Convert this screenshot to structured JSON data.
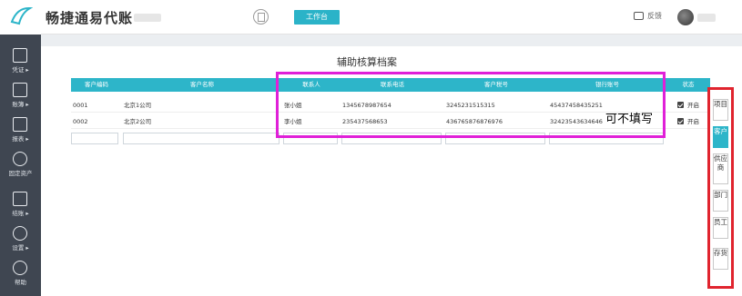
{
  "app": {
    "title": "畅捷通易代账",
    "workbench_label": "工作台",
    "feedback_label": "反馈"
  },
  "sidebar": {
    "items": [
      {
        "label": "凭证 ▸",
        "icon": "voucher-icon"
      },
      {
        "label": "账簿 ▸",
        "icon": "ledger-icon"
      },
      {
        "label": "报表 ▸",
        "icon": "report-icon"
      },
      {
        "label": "固定资产",
        "icon": "fixed-asset-icon"
      },
      {
        "label": "结账 ▸",
        "icon": "closing-icon"
      },
      {
        "label": "设置 ▸",
        "icon": "settings-icon"
      },
      {
        "label": "帮助",
        "icon": "help-icon"
      }
    ]
  },
  "page": {
    "title": "辅助核算档案"
  },
  "table": {
    "columns": [
      "客户编码",
      "客户名称",
      "联系人",
      "联系电话",
      "客户税号",
      "银行账号",
      "状态"
    ],
    "rows": [
      {
        "code": "0001",
        "name": "北京1公司",
        "contact": "张小姐",
        "phone": "1345678987654",
        "tax_id": "3245231515315",
        "bank": "45437458435251",
        "status": "开启"
      },
      {
        "code": "0002",
        "name": "北京2公司",
        "contact": "李小姐",
        "phone": "235437568653",
        "tax_id": "436765876876976",
        "bank": "32423543634646",
        "status": "开启"
      }
    ]
  },
  "annotation": "可不填写",
  "right_tabs": [
    {
      "label": "项目",
      "active": false
    },
    {
      "label": "客户",
      "active": true
    },
    {
      "label": "供应商",
      "active": false
    },
    {
      "label": "部门",
      "active": false
    },
    {
      "label": "员工",
      "active": false
    },
    {
      "label": "存货",
      "active": false
    }
  ],
  "colors": {
    "accent": "#2db5c9",
    "sidebar_bg": "#3f4651",
    "highlight_magenta": "#e020d8",
    "highlight_red": "#e0242e"
  }
}
